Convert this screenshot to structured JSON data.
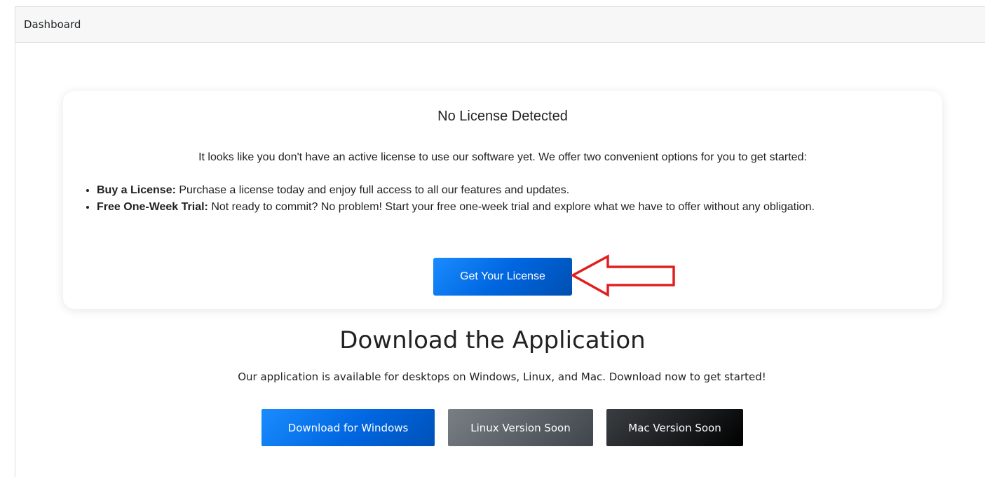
{
  "header": {
    "title": "Dashboard"
  },
  "license_card": {
    "title": "No License Detected",
    "intro": "It looks like you don't have an active license to use our software yet. We offer two convenient options for you to get started:",
    "options": [
      {
        "label": "Buy a License:",
        "text": " Purchase a license today and enjoy full access to all our features and updates."
      },
      {
        "label": "Free One-Week Trial:",
        "text": " Not ready to commit? No problem! Start your free one-week trial and explore what we have to offer without any obligation."
      }
    ],
    "button_label": "Get Your License"
  },
  "download": {
    "title": "Download the Application",
    "description": "Our application is available for desktops on Windows, Linux, and Mac. Download now to get started!",
    "buttons": {
      "windows": "Download for Windows",
      "linux": "Linux Version Soon",
      "mac": "Mac Version Soon"
    }
  },
  "colors": {
    "primary": "#0066e0",
    "annotation_arrow": "#e02020"
  }
}
